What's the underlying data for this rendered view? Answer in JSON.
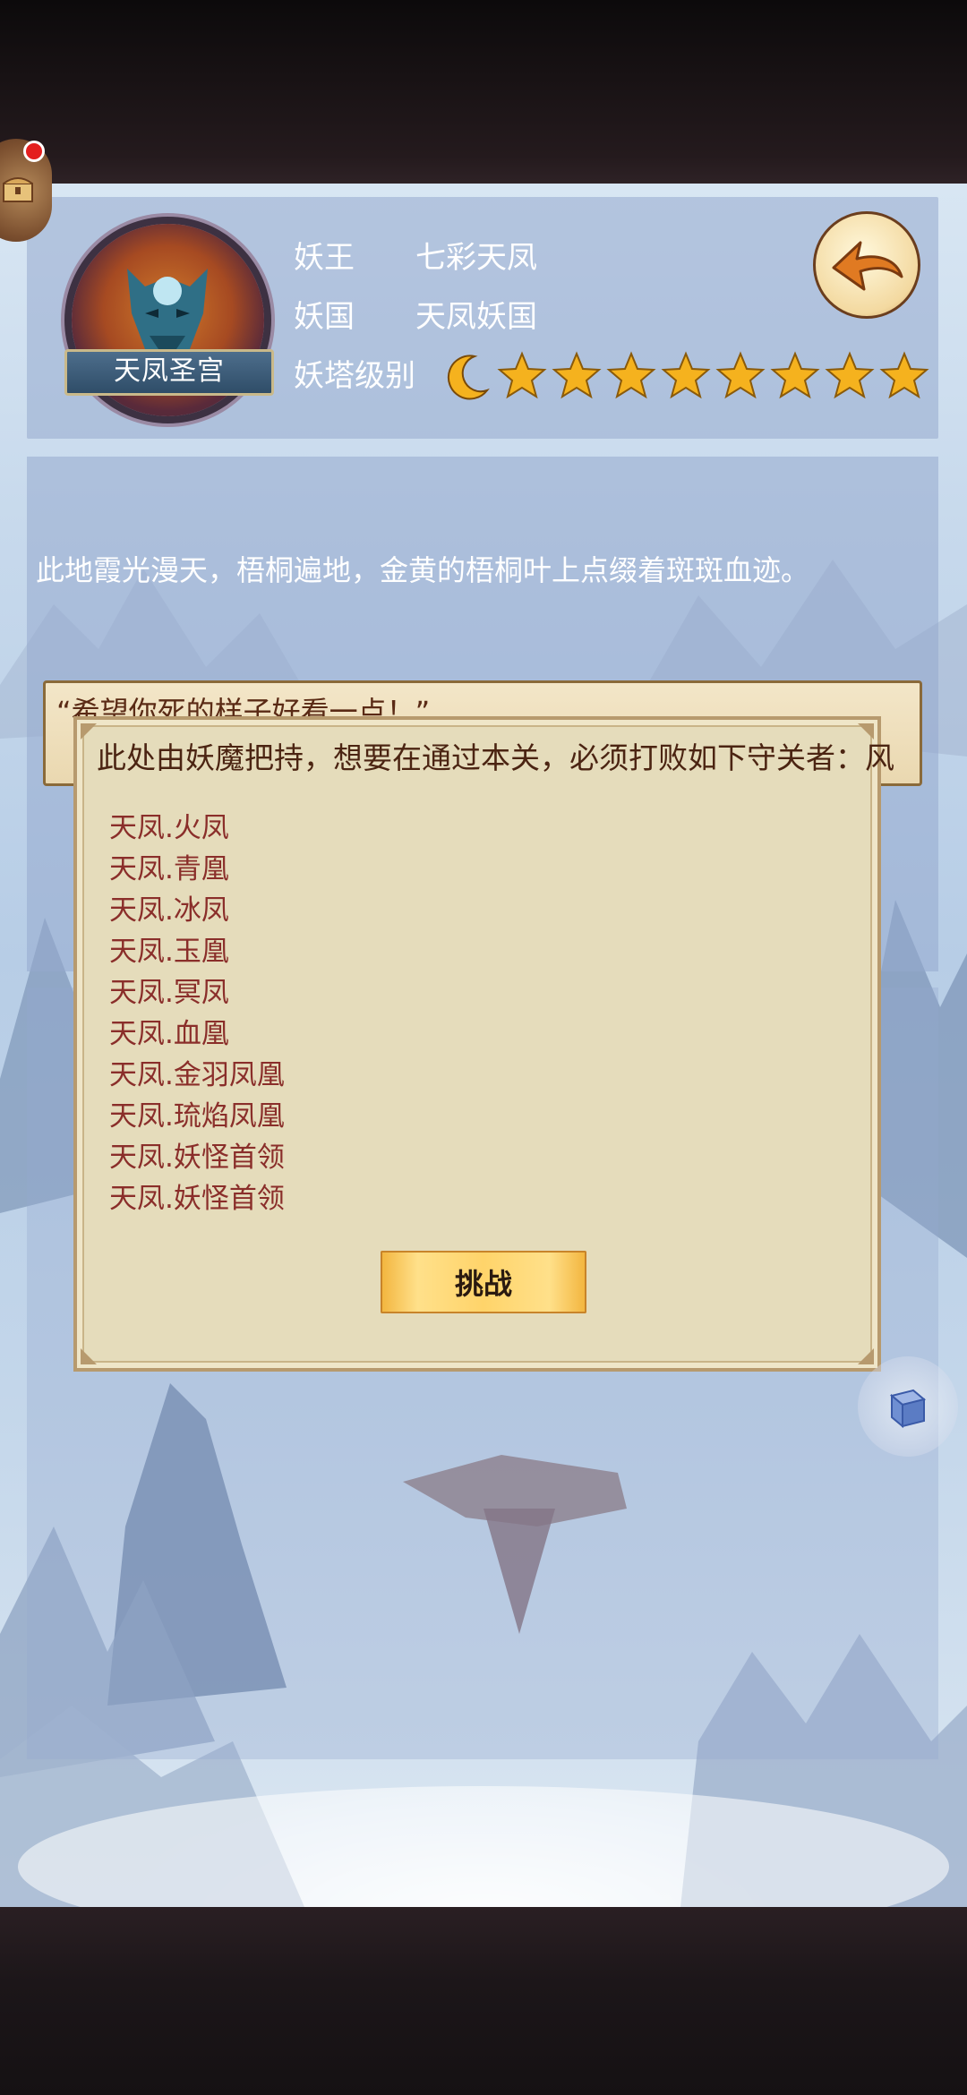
{
  "tower": {
    "emblem_name": "天凤圣宫",
    "king_label": "妖王",
    "king_value": "七彩天凤",
    "kingdom_label": "妖国",
    "kingdom_value": "天凤妖国",
    "level_label": "妖塔级别",
    "level_moons": 1,
    "level_stars": 8
  },
  "description": "此地霞光漫天，梧桐遍地，金黄的梧桐叶上点缀着斑斑血迹。",
  "quote": "“希望你死的样子好看一点！”",
  "dialog": {
    "title": "此处由妖魔把持，想要在通过本关，必须打败如下守关者：风",
    "guardians": [
      "天凤.火凤",
      "天凤.青凰",
      "天凤.冰凤",
      "天凤.玉凰",
      "天凤.冥凤",
      "天凤.血凰",
      "天凤.金羽凤凰",
      "天凤.琉焰凤凰",
      "天凤.妖怪首领",
      "天凤.妖怪首领"
    ],
    "challenge_label": "挑战"
  },
  "icons": {
    "back": "back-arrow-icon",
    "chest": "treasure-chest-icon",
    "cube": "cube-icon",
    "star": "star-icon",
    "moon": "crescent-moon-icon"
  },
  "colors": {
    "star": "#f5b21e",
    "guardian_text": "#8a2e2a",
    "dialog_bg": "#e5dcbb"
  }
}
